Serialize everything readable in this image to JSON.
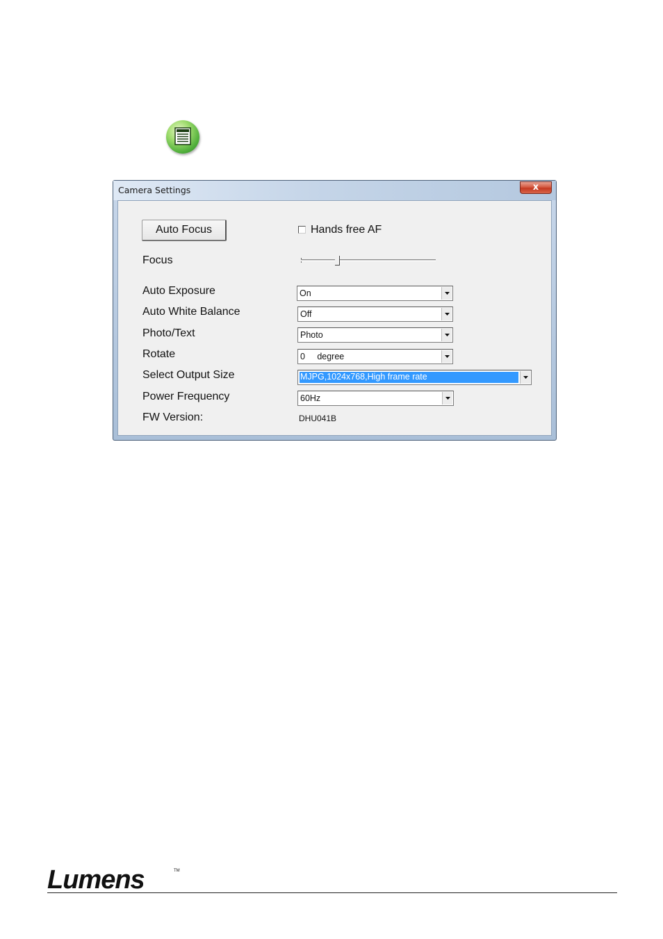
{
  "dialog": {
    "title": "Camera Settings",
    "close_label": "x"
  },
  "controls": {
    "auto_focus_button": "Auto Focus",
    "hands_free_af_label": "Hands free AF",
    "hands_free_af_checked": false,
    "focus_label": "Focus",
    "focus_slider_fraction": 0.27,
    "auto_exposure_label": "Auto Exposure",
    "auto_exposure_value": "On",
    "auto_white_balance_label": "Auto White Balance",
    "auto_white_balance_value": "Off",
    "photo_text_label": "Photo/Text",
    "photo_text_value": "Photo",
    "rotate_label": "Rotate",
    "rotate_value": "0     degree",
    "output_size_label": "Select Output Size",
    "output_size_value": "MJPG,1024x768,High frame rate",
    "power_frequency_label": "Power Frequency",
    "power_frequency_value": "60Hz",
    "fw_version_label": "FW Version:",
    "fw_version_value": "DHU041B"
  },
  "footer": {
    "brand": "Lumens",
    "trademark": "TM"
  },
  "colors": {
    "selection": "#3399ff",
    "icon_green": "#4fae3a",
    "close_red": "#c43a22"
  },
  "icons": [
    "settings-icon",
    "close-icon",
    "dropdown-arrow-icon"
  ]
}
